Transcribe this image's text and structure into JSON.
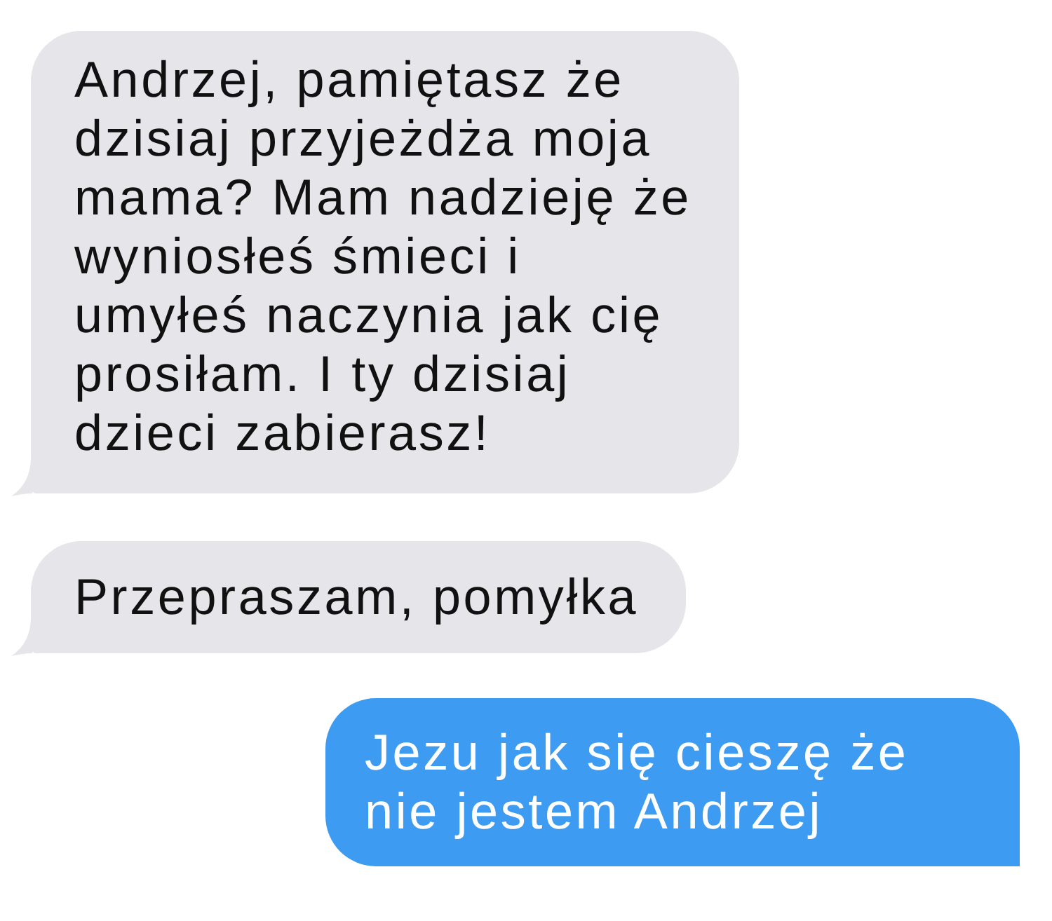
{
  "messages": [
    {
      "kind": "received",
      "lines": [
        "Andrzej, pamiętasz że",
        "dzisiaj przyjeżdża moja",
        "mama? Mam nadzieję że",
        "wyniosłeś śmieci i",
        "umyłeś naczynia jak cię",
        "prosiłam. I ty dzisiaj",
        "dzieci zabierasz!"
      ]
    },
    {
      "kind": "received",
      "lines": [
        "Przepraszam, pomyłka"
      ]
    },
    {
      "kind": "sent",
      "lines": [
        "Jezu jak się cieszę że",
        "nie jestem Andrzej"
      ]
    }
  ]
}
